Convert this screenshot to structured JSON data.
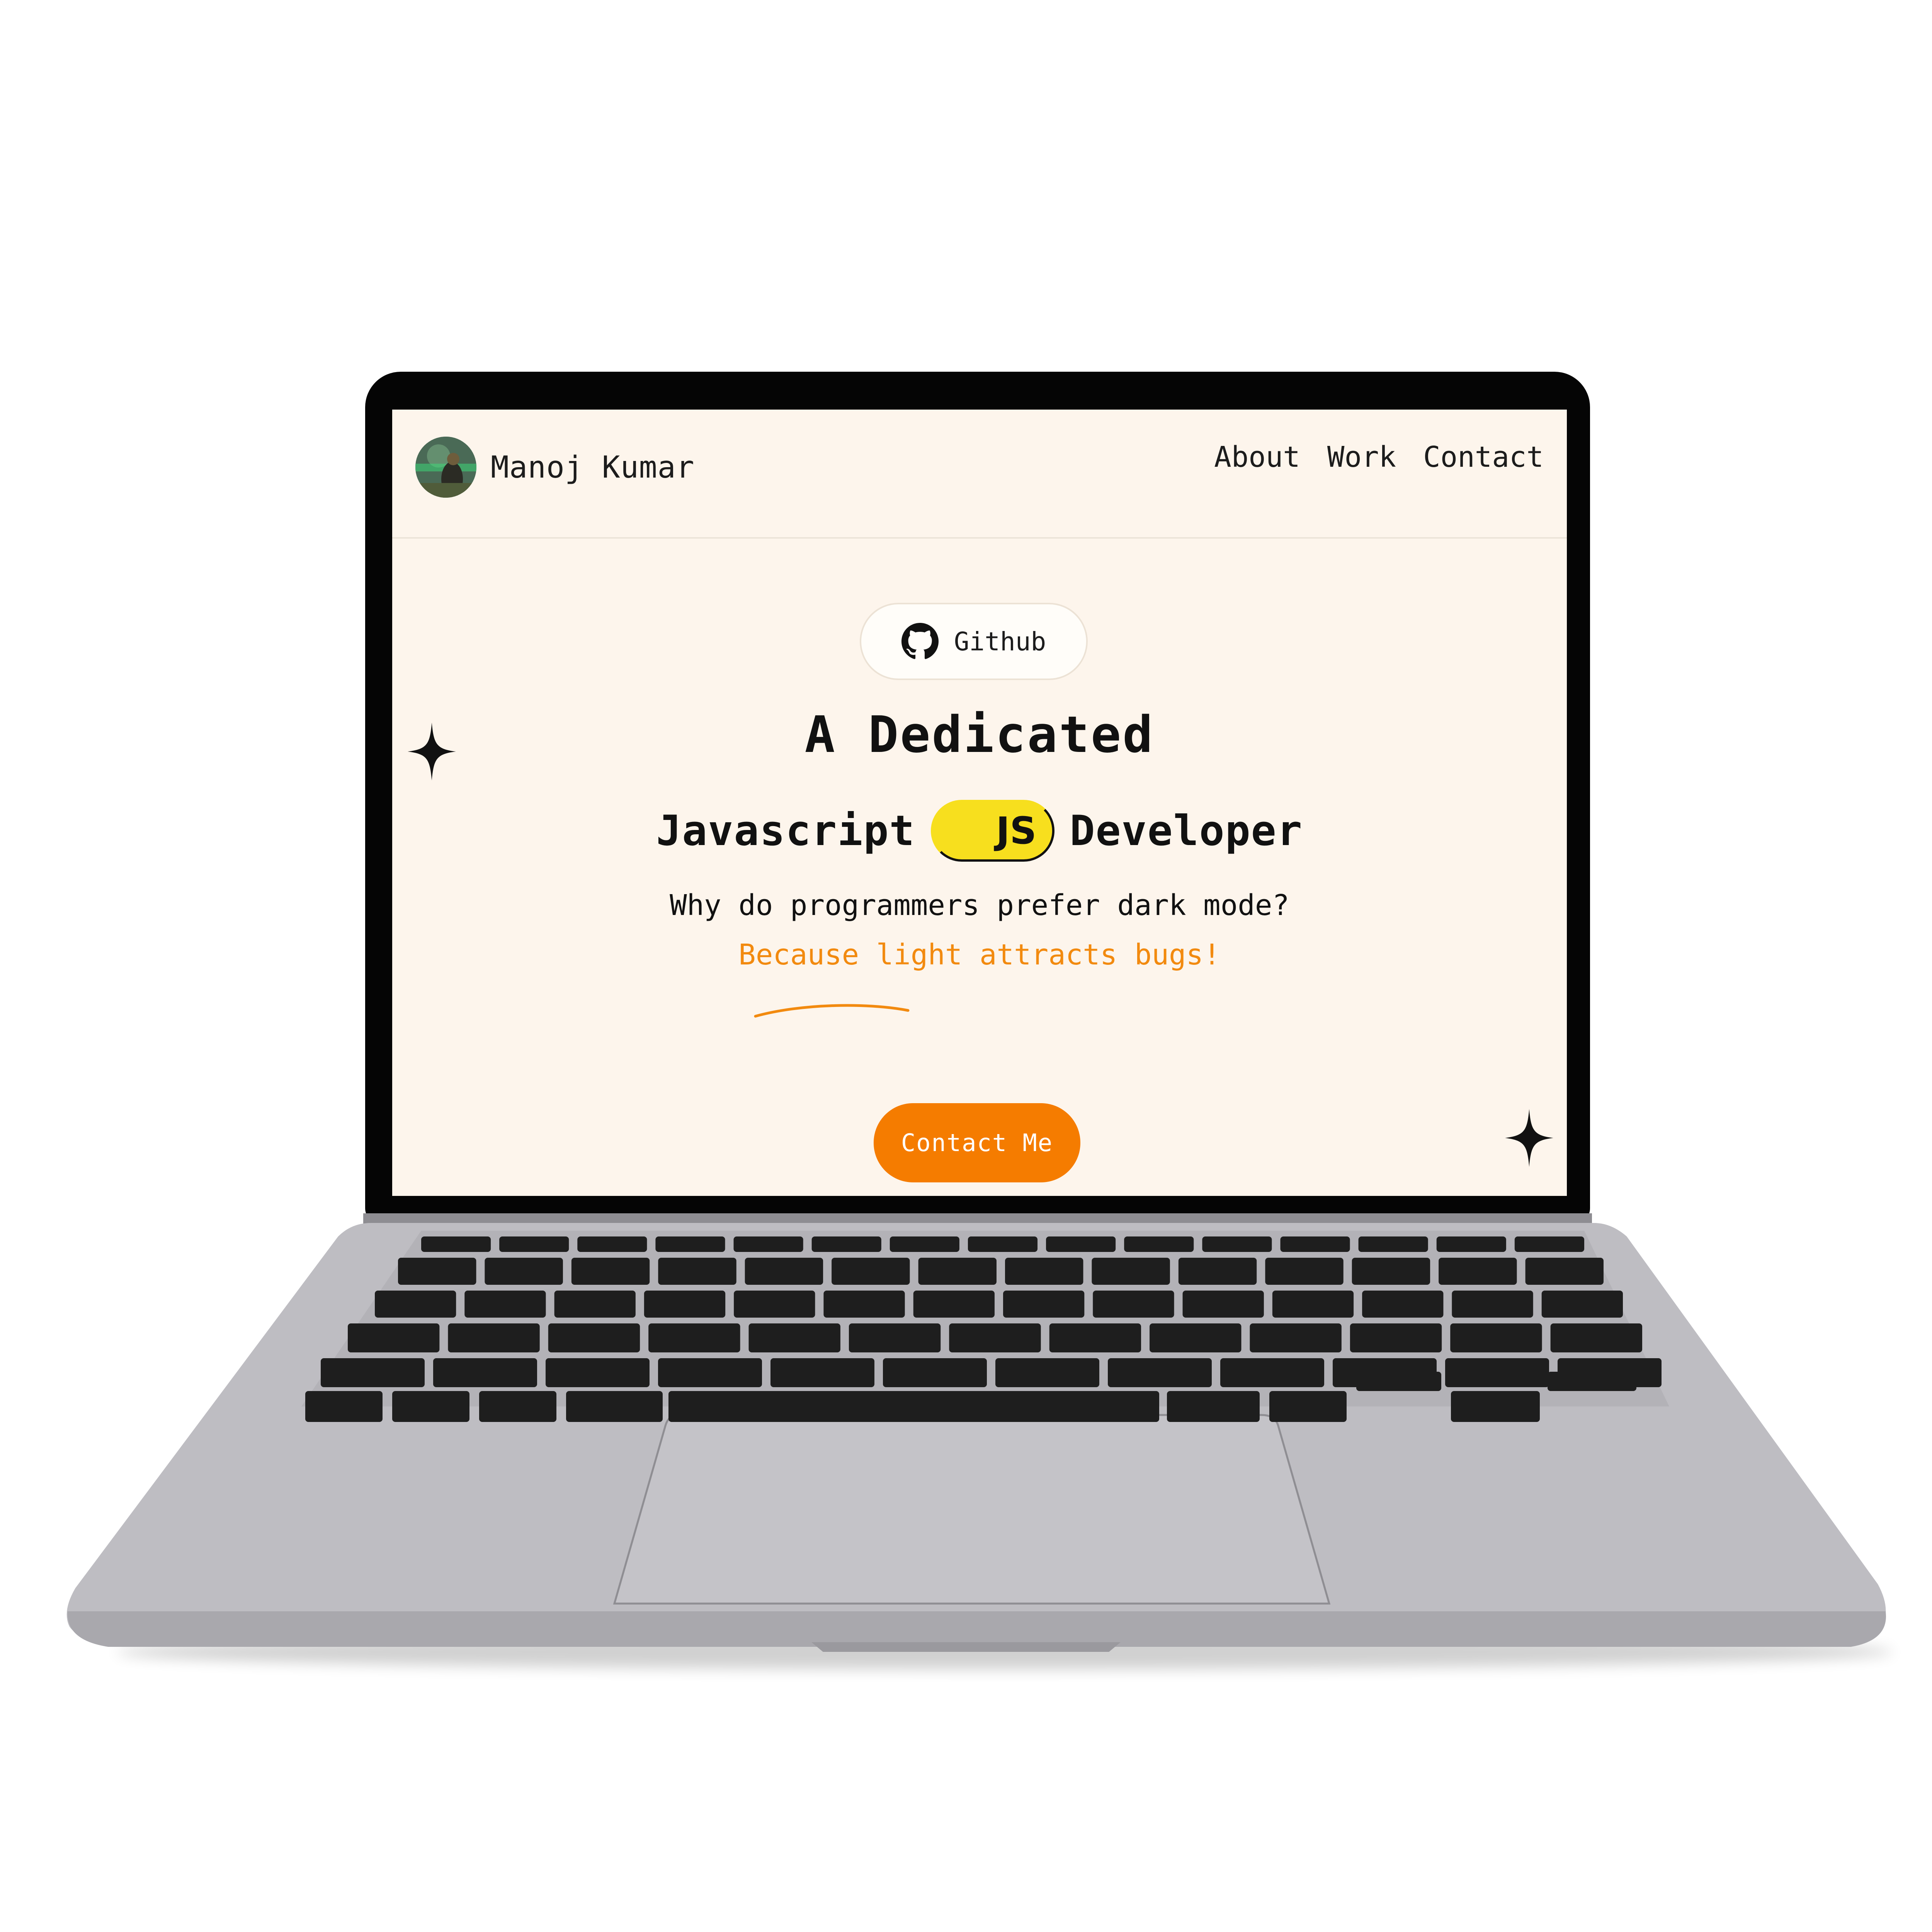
{
  "site": {
    "brand_name": "Manoj Kumar",
    "nav": [
      "About",
      "Work",
      "Contact"
    ],
    "github_label": "Github",
    "heading_line1": "A Dedicated",
    "heading_word1": "Javascript",
    "js_badge": "JS",
    "heading_word2": "Developer",
    "joke_question": "Why do programmers prefer dark mode?",
    "joke_answer": "Because light attracts bugs!",
    "cta_label": "Contact Me"
  },
  "colors": {
    "page_bg": "#fdf5ec",
    "accent": "#f57c00",
    "answer_text": "#f28a0f",
    "js_yellow": "#f7df1e",
    "laptop_body": "#bebdc2",
    "keys": "#1e1e1e"
  },
  "icons": [
    "github-icon",
    "sparkle-icon"
  ]
}
